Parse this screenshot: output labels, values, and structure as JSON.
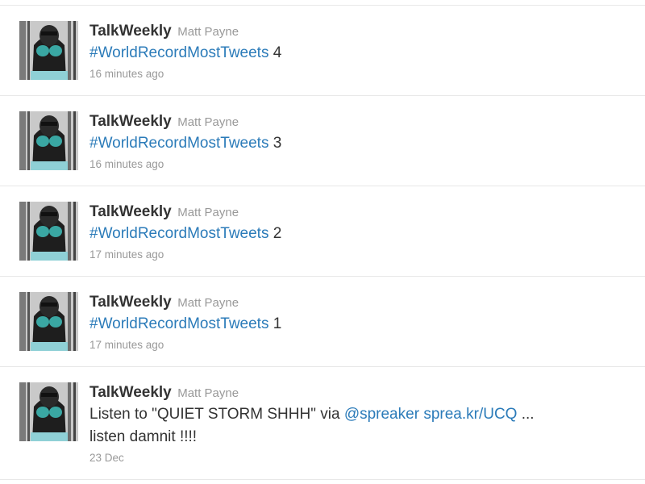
{
  "tweets": [
    {
      "screen_name": "TalkWeekly",
      "full_name": "Matt Payne",
      "hashtag": "#WorldRecordMostTweets",
      "suffix": "4",
      "time": "16 minutes ago"
    },
    {
      "screen_name": "TalkWeekly",
      "full_name": "Matt Payne",
      "hashtag": "#WorldRecordMostTweets",
      "suffix": "3",
      "time": "16 minutes ago"
    },
    {
      "screen_name": "TalkWeekly",
      "full_name": "Matt Payne",
      "hashtag": "#WorldRecordMostTweets",
      "suffix": "2",
      "time": "17 minutes ago"
    },
    {
      "screen_name": "TalkWeekly",
      "full_name": "Matt Payne",
      "hashtag": "#WorldRecordMostTweets",
      "suffix": "1",
      "time": "17 minutes ago"
    },
    {
      "screen_name": "TalkWeekly",
      "full_name": "Matt Payne",
      "text_prefix": "Listen to \"QUIET STORM SHHH\" via",
      "mention": "@spreaker",
      "link": "sprea.kr/UCQ",
      "text_ellipsis": "...",
      "text_line2": "listen damnit !!!!",
      "time": "23 Dec"
    }
  ],
  "colors": {
    "link": "#2b7bb9",
    "text": "#333333",
    "muted": "#999999",
    "divider": "#e8e8e8"
  },
  "icons": {
    "avatar": "profile-photo"
  }
}
